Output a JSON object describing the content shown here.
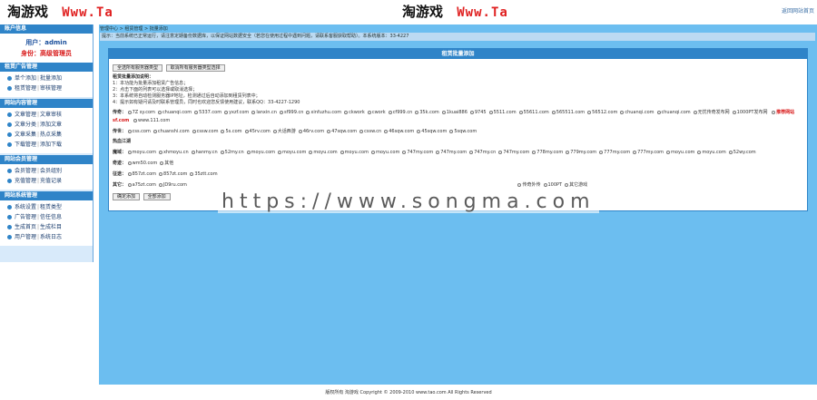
{
  "header": {
    "logo_cn": "淘游戏",
    "logo_www": "Www.Ta",
    "right_link": "返回网站首页"
  },
  "sidebar": {
    "sections": [
      {
        "title": "账户信息",
        "user_label": "用户：admin",
        "role_label": "身份：高级管理员"
      },
      {
        "title": "租赁广告管理",
        "rows": [
          [
            "单个添加",
            "批量添加"
          ],
          [
            "租赁管理",
            "审核管理"
          ]
        ]
      },
      {
        "title": "网站内容管理",
        "rows": [
          [
            "文章管理",
            "文章审核"
          ],
          [
            "文章分类",
            "添加文章"
          ],
          [
            "文章采集",
            "热点采集"
          ],
          [
            "下载管理",
            "添加下载"
          ]
        ]
      },
      {
        "title": "网站会员管理",
        "rows": [
          [
            "会员管理",
            "会员组别"
          ],
          [
            "充值管理",
            "充值记录"
          ]
        ]
      },
      {
        "title": "网站系统管理",
        "rows": [
          [
            "系统设置",
            "租赁类型"
          ],
          [
            "广告管理",
            "信任信息"
          ],
          [
            "生成首页",
            "生成栏目"
          ],
          [
            "用户管理",
            "系统日志"
          ]
        ]
      }
    ]
  },
  "main": {
    "address": "管理中心 > 租赁管理 > 批量添加",
    "notice": "提示：当前系统已正常运行，请注意定期备份数据库，以保证网站数据安全（若您在使用过程中遇到问题，请联系客服获取帮助）。本系统版本：33-4227",
    "panel_title": "租赁批量添加",
    "buttons": [
      "全选所有服务器类型",
      "取消所有服务器类型选择"
    ],
    "notes_title": "租赁批量添加说明：",
    "notes": [
      "1：本功能为批量添加租赁广告信息；",
      "2：点击下面的列表可以选择或取消选择；",
      "3：本系统将自动检测服务器IP地址，检测通过后自动添加到租赁列表中；",
      "4：提示如有疑问请及时联系管理员，同时也欢迎您反馈使用建议，联系QQ：33-4227-1290"
    ],
    "row1_label": "传奇：",
    "row1_opts": [
      "7Z sy.com",
      "chuanqi.com",
      "5337.com",
      "yxzf.com",
      "lanxin.cn",
      "sf999.cn",
      "xinfuzhu.com",
      "ckwork",
      "cwork",
      "cf999.cn",
      "35k.com",
      "1kuai886",
      "9745",
      "5511.com",
      "55611.com",
      "565511.com",
      "56512.com",
      "chuanqi.com",
      "chuanqi.com",
      "无忧传奇发布网",
      "1000PT发布网"
    ],
    "row1_extra": "sf.com",
    "row1_red": "推荐网站",
    "row1_more": "www.111.com",
    "row2_label": "传世：",
    "row2_opts": [
      "css.com",
      "chuanshi.com",
      "cssw.com",
      "5s.com",
      "45rv.com",
      "大话西游",
      "46rv.com",
      "47sqw.com",
      "cssw.cn",
      "46sqw.com",
      "45sqw.com",
      "5sqw.com"
    ],
    "section2_title": "热血江湖",
    "row3_label": "魔域：",
    "row3_opts": [
      "moyu.com",
      "xhmoyu.cn",
      "hanmy.cn",
      "52my.cn",
      "moyu.com",
      "moyu.com",
      "moyu.com",
      "moyu.com",
      "moyu.com",
      "747my.com",
      "747my.com",
      "747my.cn",
      "747my.com",
      "778my.com",
      "779my.com",
      "777my.com",
      "777my.com",
      "moyu.com",
      "moyu.com",
      "52wy.com"
    ],
    "row4_label": "奇迹：",
    "row4_opts": [
      "wm50.com",
      "其他"
    ],
    "row5_label": "征途：",
    "row5_opts": [
      "857zt.com",
      "857zt.com",
      "35ztt.com"
    ],
    "row6_label": "其它：",
    "row6_opts": [
      "a75zt.com",
      "JD9ru.com"
    ],
    "row6_right": [
      "传奇外传",
      "100PT",
      "其它游戏"
    ],
    "submit_buttons": [
      "确定添加",
      "全部添加"
    ]
  },
  "watermark": "https://www.songma.com",
  "footer": "版权所有 淘游戏  Copyright © 2009-2010 www.tao.com  All Rights Reserved"
}
